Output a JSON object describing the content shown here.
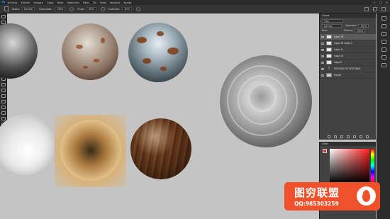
{
  "app": {
    "logo_text": "Ps"
  },
  "menu": {
    "items": [
      "Archivo",
      "Edición",
      "Imagen",
      "Capa",
      "Texto",
      "Selección",
      "Filtro",
      "3D",
      "Vista",
      "Ventana",
      "Ayuda"
    ]
  },
  "window_controls": {
    "minimize": "—",
    "maximize": "□",
    "close": "✕"
  },
  "options": {
    "mode_label": "Modo:",
    "mode_value": "Normal",
    "opacity_label": "Opacidad:",
    "opacity_value": "100%",
    "flow_label": "Flujo:",
    "flow_value": "40%",
    "smoothing_label": "Suavizar:",
    "smoothing_value": "10%"
  },
  "layers_panel": {
    "tab": "Capas",
    "kind_value": "Tipo",
    "blend_value": "Normal",
    "opacity_label": "Opacidad:",
    "opacity_value": "100%",
    "lock_label": "Bloq.:",
    "fill_label": "Relleno:",
    "fill_value": "100%",
    "layers": [
      {
        "name": "Capa 18",
        "kind": "pixel",
        "selected": true
      },
      {
        "name": "Capa 18 copia 2",
        "kind": "pixel",
        "selected": false
      },
      {
        "name": "Capa 11",
        "kind": "pixel",
        "selected": false
      },
      {
        "name": "Capa 10",
        "kind": "pixel",
        "selected": false
      },
      {
        "name": "Capa 6",
        "kind": "pixel",
        "selected": false
      },
      {
        "name": "ESTUDIO DE TEXTURAS",
        "kind": "text",
        "selected": false
      },
      {
        "name": "Fondo",
        "kind": "pixel",
        "selected": false
      }
    ]
  },
  "color_panel": {
    "tab": "Color",
    "foreground": "#e23a3a"
  },
  "watermark": {
    "title": "图穷联盟",
    "contact": "QQ:985303259",
    "color": "#f0502a"
  }
}
